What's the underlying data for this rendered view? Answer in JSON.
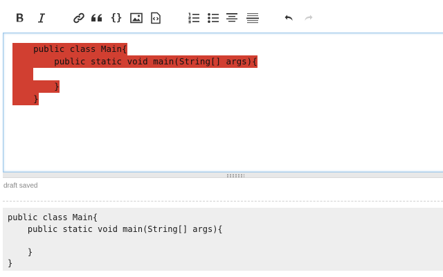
{
  "toolbar": {
    "buttons": [
      {
        "name": "bold-button",
        "icon": "bold-icon",
        "title": "Strong"
      },
      {
        "name": "italic-button",
        "icon": "italic-icon",
        "title": "Emphasis"
      },
      {
        "name": "link-button",
        "icon": "link-icon",
        "title": "Hyperlink"
      },
      {
        "name": "blockquote-button",
        "icon": "quote-icon",
        "title": "Blockquote"
      },
      {
        "name": "code-button",
        "icon": "braces-icon",
        "title": "Code Sample"
      },
      {
        "name": "image-button",
        "icon": "image-icon",
        "title": "Image"
      },
      {
        "name": "snippet-button",
        "icon": "snippet-icon",
        "title": "Snippet"
      },
      {
        "name": "numbered-list-button",
        "icon": "numbered-list-icon",
        "title": "Numbered List"
      },
      {
        "name": "bulleted-list-button",
        "icon": "bulleted-list-icon",
        "title": "Bulleted List"
      },
      {
        "name": "heading-button",
        "icon": "heading-icon",
        "title": "Heading"
      },
      {
        "name": "horizontal-rule-button",
        "icon": "horizontal-rule-icon",
        "title": "Horizontal Rule"
      },
      {
        "name": "undo-button",
        "icon": "undo-icon",
        "title": "Undo"
      },
      {
        "name": "redo-button",
        "icon": "redo-icon",
        "title": "Redo"
      }
    ],
    "braces_glyph": "{}"
  },
  "editor": {
    "lines": [
      "    public class Main{",
      "        public static void main(String[] args){",
      "    ",
      "        }",
      "    }"
    ],
    "selection_color": "#d13f31"
  },
  "status": {
    "draft_text": "draft saved"
  },
  "preview": {
    "code": "public class Main{\n    public static void main(String[] args){\n    \n    }\n}"
  },
  "colors": {
    "icon": "#333333",
    "icon_disabled": "#cccccc",
    "editor_border": "#9cc7ea",
    "preview_bg": "#eeeeee"
  }
}
